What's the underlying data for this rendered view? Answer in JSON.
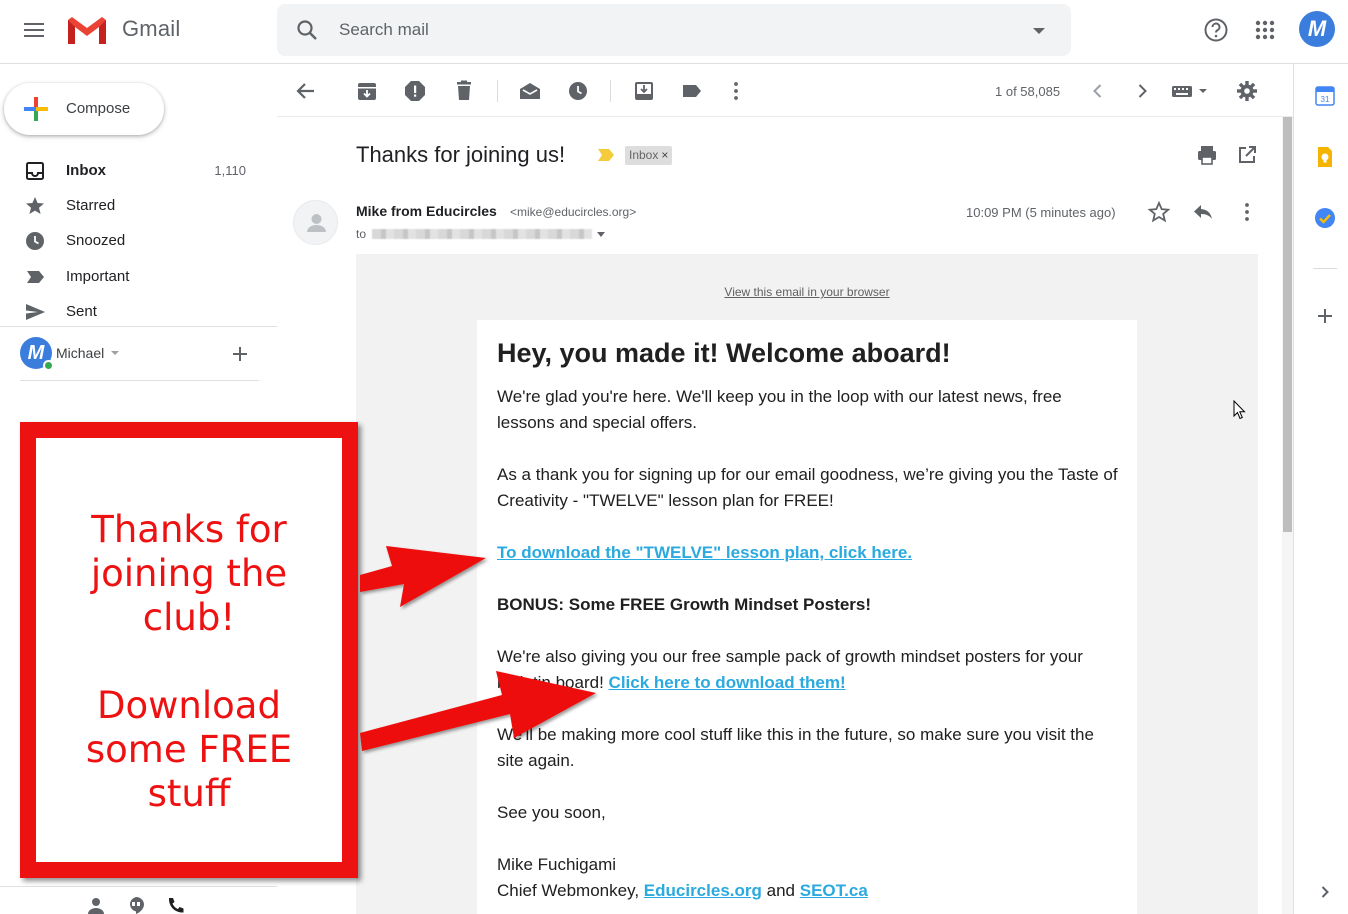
{
  "app": {
    "name": "Gmail",
    "account_initial": "M"
  },
  "search": {
    "placeholder": "Search mail"
  },
  "compose": {
    "label": "Compose"
  },
  "sidebar": {
    "items": [
      {
        "label": "Inbox",
        "count": "1,110",
        "icon": "inbox-icon",
        "active": true
      },
      {
        "label": "Starred",
        "count": "",
        "icon": "star-icon"
      },
      {
        "label": "Snoozed",
        "count": "",
        "icon": "clock-icon"
      },
      {
        "label": "Important",
        "count": "",
        "icon": "important-icon"
      },
      {
        "label": "Sent",
        "count": "",
        "icon": "send-icon"
      }
    ],
    "hangouts_user": "Michael"
  },
  "toolbar": {
    "pager": "1 of 58,085"
  },
  "message": {
    "subject": "Thanks for joining us!",
    "label_chip": "Inbox",
    "chip_close": "×",
    "sender_name": "Mike from Educircles",
    "sender_email": "<mike@educircles.org>",
    "to_label": "to",
    "timestamp": "10:09 PM (5 minutes ago)"
  },
  "email": {
    "view_in_browser": "View this email in your browser",
    "heading": "Hey, you made it! Welcome aboard!",
    "p1": "We're glad you're here. We'll keep you in the loop with our latest news, free lessons and special offers.",
    "p2": "As a thank you for signing up for our email goodness, we’re giving you the Taste of Creativity - \"TWELVE\" lesson plan for FREE!",
    "link1": "To download the \"TWELVE\" lesson plan, click here.",
    "bonus": "BONUS: Some FREE Growth Mindset Posters!",
    "p3": "We're also giving you our free sample pack of growth mindset posters for your bulletin board!",
    "link2": "Click here to download them!",
    "p4": "We'll be making more cool stuff like this in the future, so make sure you visit the site again.",
    "p5": "See you soon,",
    "sig_name": "Mike Fuchigami",
    "sig_title": "Chief Webmonkey,",
    "sig_link1": "Educircles.org",
    "sig_and": "and",
    "sig_link2": "SEOT.ca"
  },
  "annotation": {
    "line1": "Thanks for",
    "line2": "joining the",
    "line3": "club!",
    "line4": "Download",
    "line5": "some FREE",
    "line6": "stuff"
  },
  "colors": {
    "annotation_red": "#ee1111",
    "link_blue": "#2baadf",
    "account_blue": "#3b7ddd",
    "important_yellow": "#f4cb3a"
  }
}
